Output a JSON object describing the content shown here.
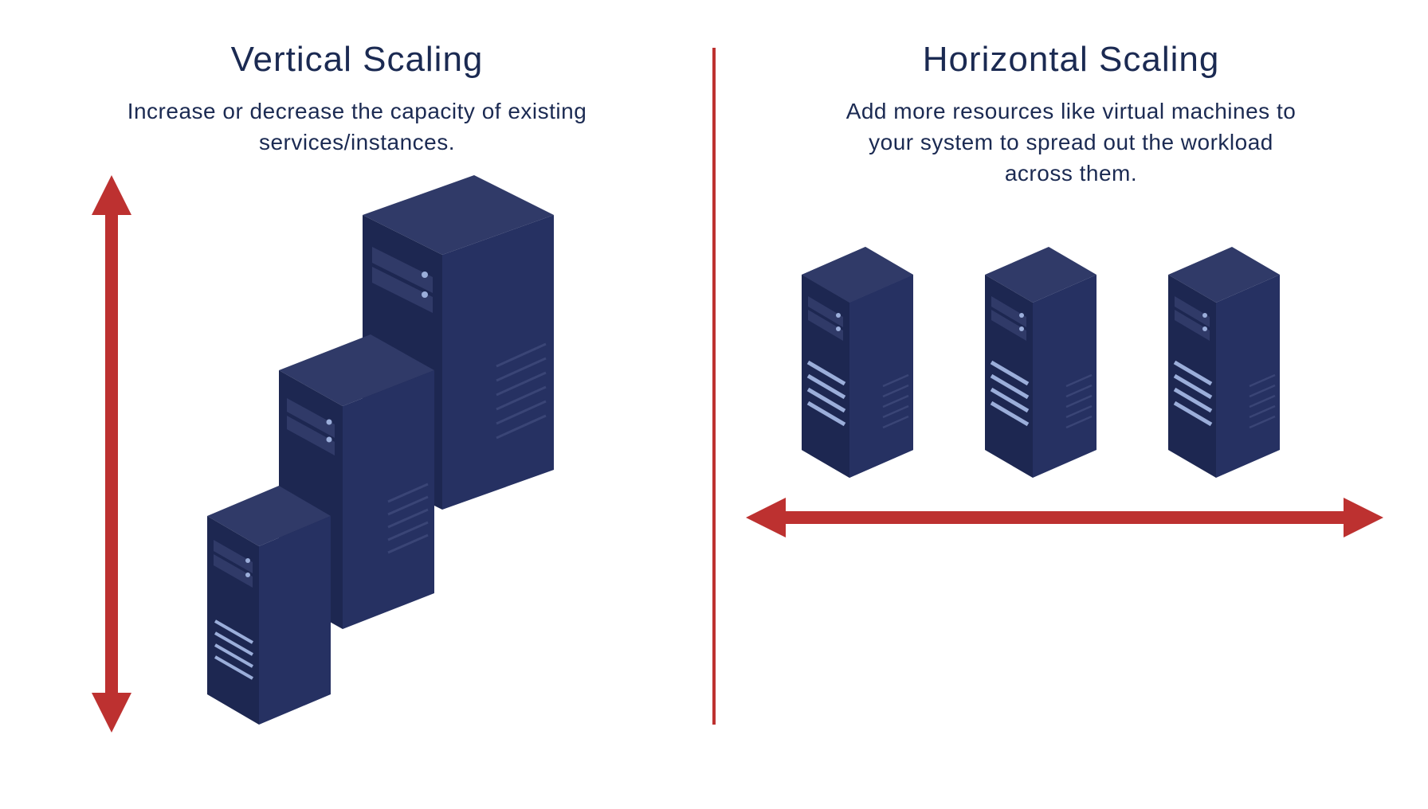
{
  "left": {
    "title": "Vertical Scaling",
    "subtitle": "Increase or decrease the capacity of existing services/instances."
  },
  "right": {
    "title": "Horizontal Scaling",
    "subtitle": "Add more resources like virtual machines to your system to spread out the workload across them."
  },
  "colors": {
    "text": "#1B2A52",
    "arrow": "#BD3130",
    "divider": "#BD3130",
    "server_top": "#303A68",
    "server_left": "#1D2751",
    "server_right": "#263162",
    "server_accent": "#9BAEDA",
    "server_light": "#D5DDF0"
  }
}
